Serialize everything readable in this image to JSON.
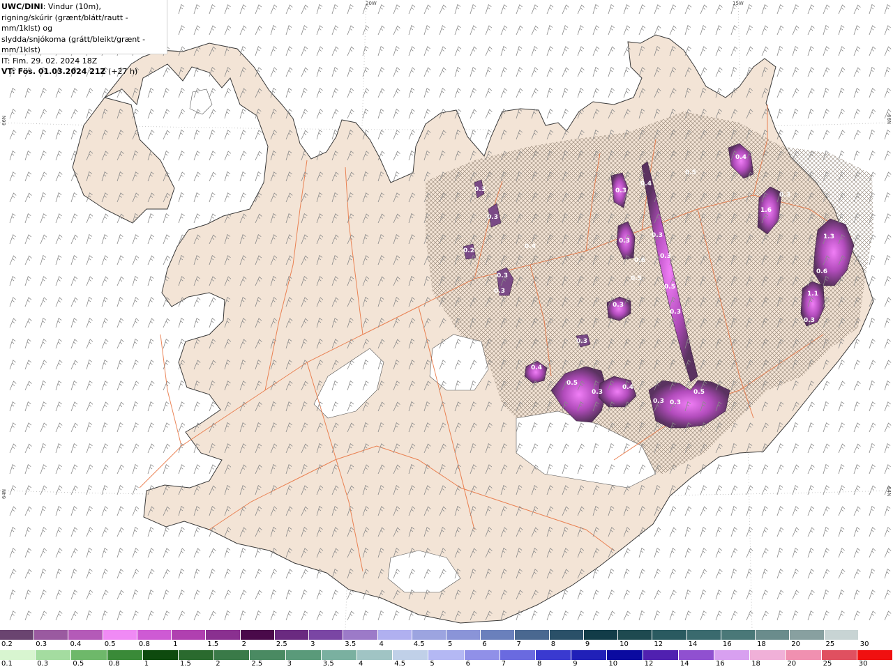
{
  "title": {
    "model": "UWC/DINI",
    "line1_rest": ": Vindur (10m),",
    "line2": "rigning/skúrir (grænt/blátt/rautt - mm/1klst) og",
    "line3": "slydda/snjókoma (grátt/bleikt/grænt - mm/1klst)",
    "it": "IT: Fim. 29. 02. 2024 18Z",
    "vt_bold": "VT: Fös. 01.03.2024 21Z",
    "vt_rest": " (+27 h)"
  },
  "grid_labels": {
    "lon_20w": "20W",
    "lon_15w": "15W",
    "lat_66n_left": "66N",
    "lat_66n_right": "66N",
    "lat_64n_left": "64N",
    "lat_64n_right": "64N"
  },
  "precip_labels": [
    "0.5",
    "0.3",
    "0.3",
    "0.3",
    "0.3",
    "0.3",
    "0.4",
    "0.3",
    "0.3",
    "0.4",
    "0.3",
    "0.4",
    "0.5",
    "0.3",
    "0.5",
    "0.3",
    "0.3",
    "1.1",
    "0.6",
    "1.3",
    "0.3",
    "1.6",
    "0.4",
    "0.5",
    "0.3",
    "0.3",
    "0.2",
    "0.3",
    "0.3",
    "0.5",
    "0.6",
    "0.4"
  ],
  "colors": {
    "land": "#f3e4d6",
    "coast": "#3a3a3a",
    "roads": "#e8703c",
    "glacier": "#ffffff",
    "snow_core": "#e070f0",
    "snow_mid": "#9a4aa8",
    "snow_outer": "#5a3260"
  },
  "scale_top": {
    "labels": [
      "0.2",
      "0.3",
      "0.4",
      "0.5",
      "0.8",
      "1",
      "1.5",
      "2",
      "2.5",
      "3",
      "3.5",
      "4",
      "4.5",
      "5",
      "6",
      "7",
      "8",
      "9",
      "10",
      "12",
      "14",
      "16",
      "18",
      "20",
      "25",
      "30"
    ],
    "colors": [
      "#6a4470",
      "#9a5aa0",
      "#b45ab8",
      "#f08af5",
      "#ce5ad4",
      "#b040b0",
      "#8a3090",
      "#4a0a4a",
      "#6a2a80",
      "#7a46a4",
      "#9c7ac8",
      "#b0b0f0",
      "#9ca4e0",
      "#8a94d8",
      "#6a80bc",
      "#4a6890",
      "#2a5068",
      "#123c48",
      "#1e4a50",
      "#2a5a60",
      "#3a6a6e",
      "#4a7878",
      "#6a8c8c",
      "#88a0a0",
      "#c8d4d4",
      "#ffffff"
    ]
  },
  "scale_bottom": {
    "labels": [
      "0.1",
      "0.3",
      "0.5",
      "0.8",
      "1",
      "1.5",
      "2",
      "2.5",
      "3",
      "3.5",
      "4",
      "4.5",
      "5",
      "6",
      "7",
      "8",
      "9",
      "10",
      "12",
      "14",
      "16",
      "18",
      "20",
      "25",
      "30"
    ],
    "colors": [
      "#d8f5d0",
      "#a4dca0",
      "#6eb86a",
      "#3a8a38",
      "#0e4a0e",
      "#2a6a2e",
      "#3a7a48",
      "#4a8a62",
      "#5a9a7a",
      "#7ab0a0",
      "#a0c4c4",
      "#c0d0e8",
      "#b4b8f4",
      "#9090e8",
      "#6a6ae0",
      "#3a3ad0",
      "#2020b8",
      "#0a0aa0",
      "#5020b0",
      "#9050d0",
      "#d8a0f0",
      "#f0b0d8",
      "#f090b0",
      "#e05060",
      "#f01010"
    ]
  }
}
